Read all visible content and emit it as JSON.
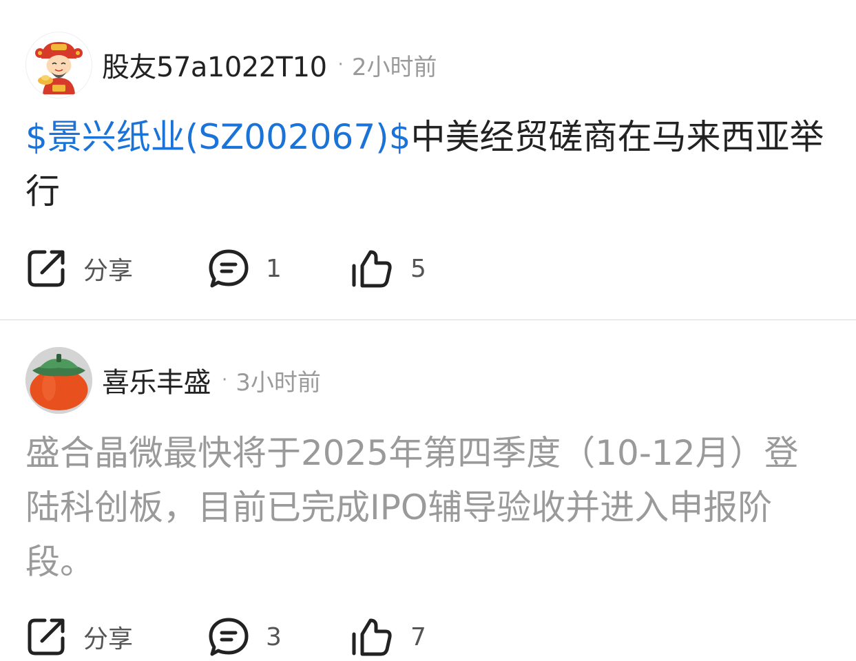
{
  "posts": [
    {
      "username": "股友57a1022T10",
      "separator": "·",
      "time": "2小时前",
      "stock_link": "$景兴纸业(SZ002067)$",
      "body": "中美经贸磋商在马来西亚举行",
      "avatar_icon": "caishen-avatar-icon",
      "actions": {
        "share_label": "分享",
        "comment_count": "1",
        "like_count": "5"
      }
    },
    {
      "username": "喜乐丰盛",
      "separator": "·",
      "time": "3小时前",
      "body": "盛合晶微最快将于2025年第四季度（10-12月）登陆科创板，目前已完成IPO辅导验收并进入申报阶段。",
      "avatar_icon": "persimmon-avatar-icon",
      "actions": {
        "share_label": "分享",
        "comment_count": "3",
        "like_count": "7"
      }
    }
  ],
  "colors": {
    "link": "#1a73d9",
    "text": "#222222",
    "muted": "#9a9a9a",
    "divider": "#d9d9d9"
  }
}
